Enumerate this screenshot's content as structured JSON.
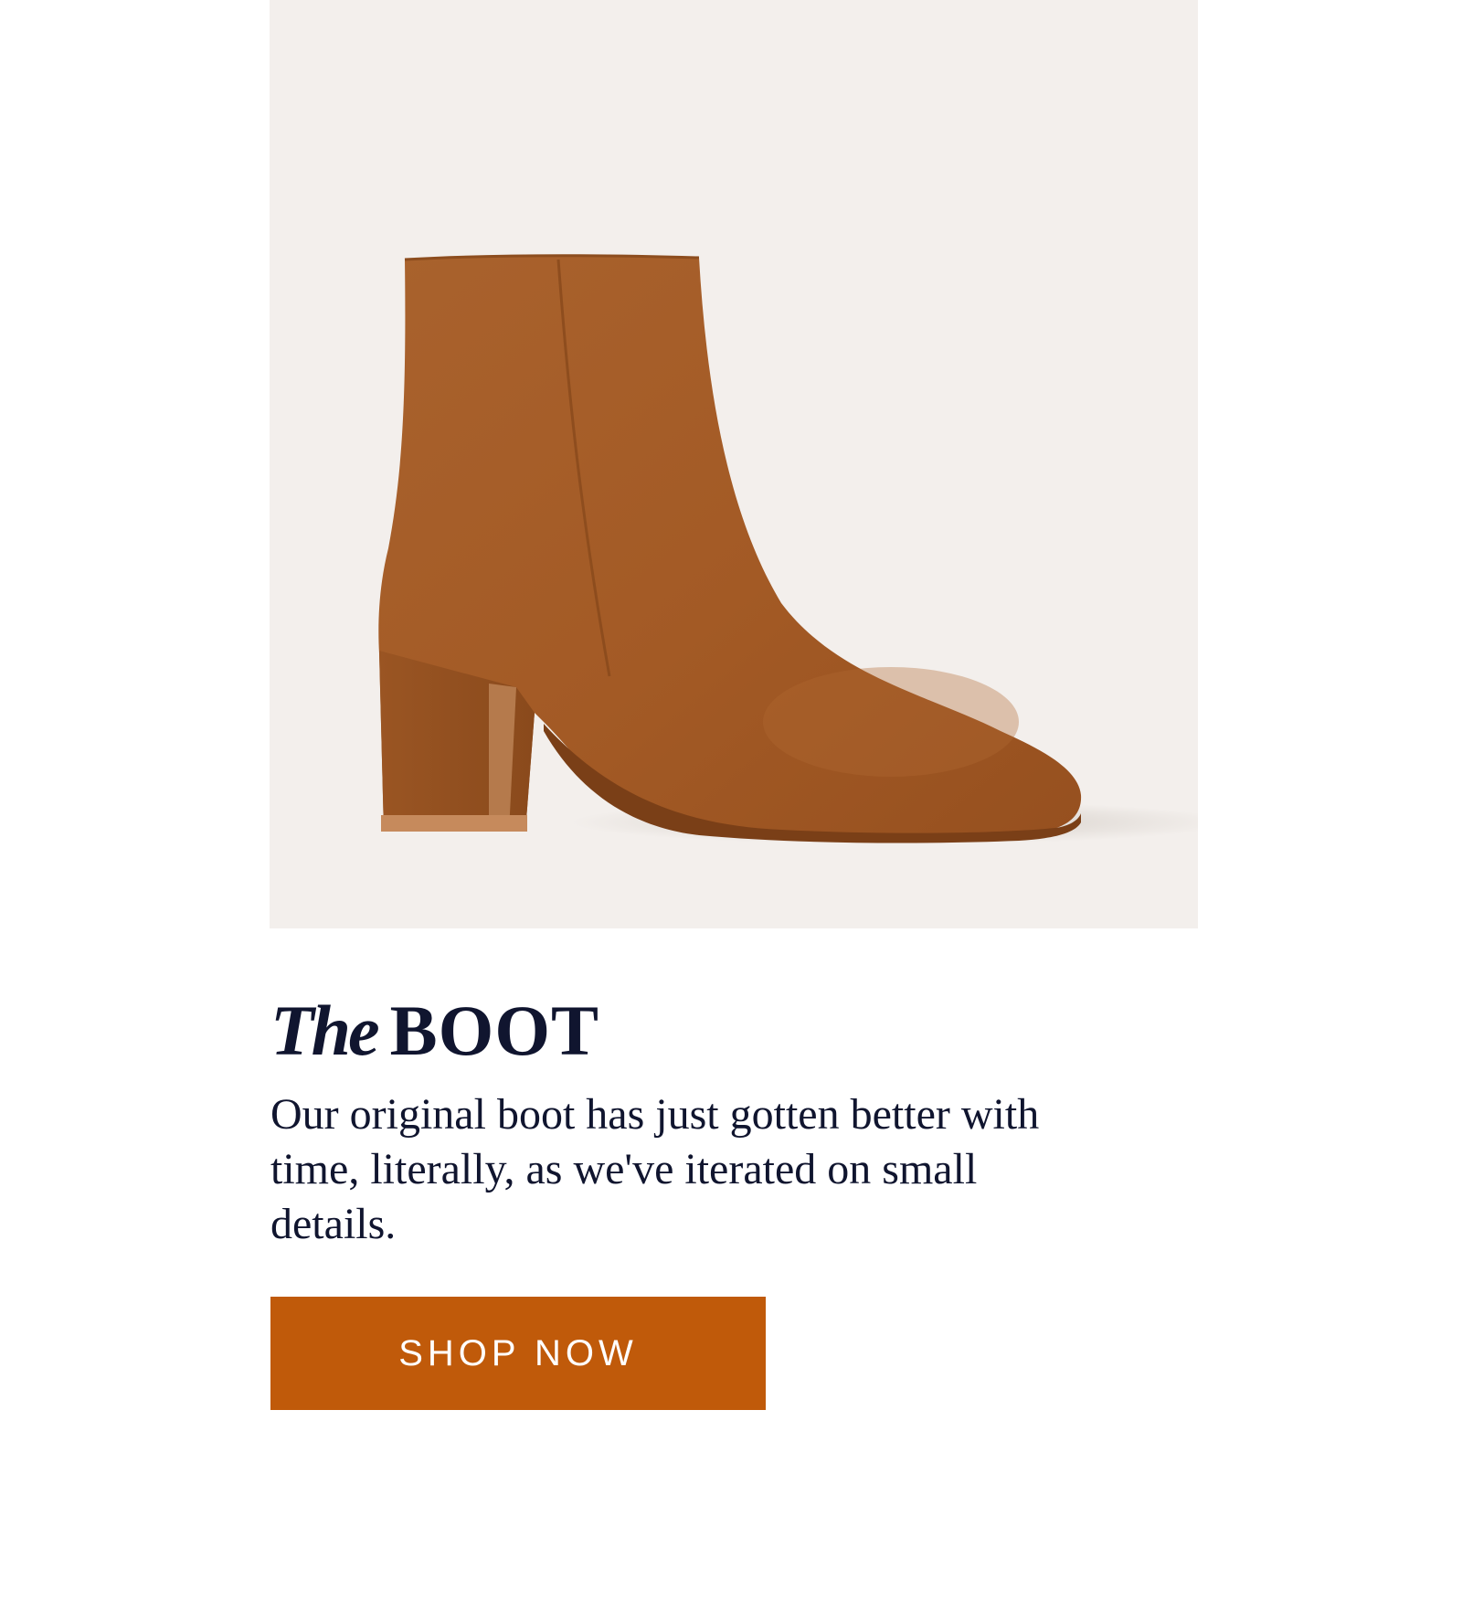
{
  "product": {
    "title_prefix": "The",
    "title_name": "BOOT",
    "description": "Our original boot has just gotten better with time, literally, as we've iterated on small details.",
    "cta_label": "SHOP NOW",
    "image_subject": "brown-suede-ankle-boot-image"
  },
  "colors": {
    "hero_background": "#f3efec",
    "boot_suede": "#a65d28",
    "text": "#10152f",
    "cta_background": "#c05a0a",
    "cta_text": "#ffffff"
  }
}
